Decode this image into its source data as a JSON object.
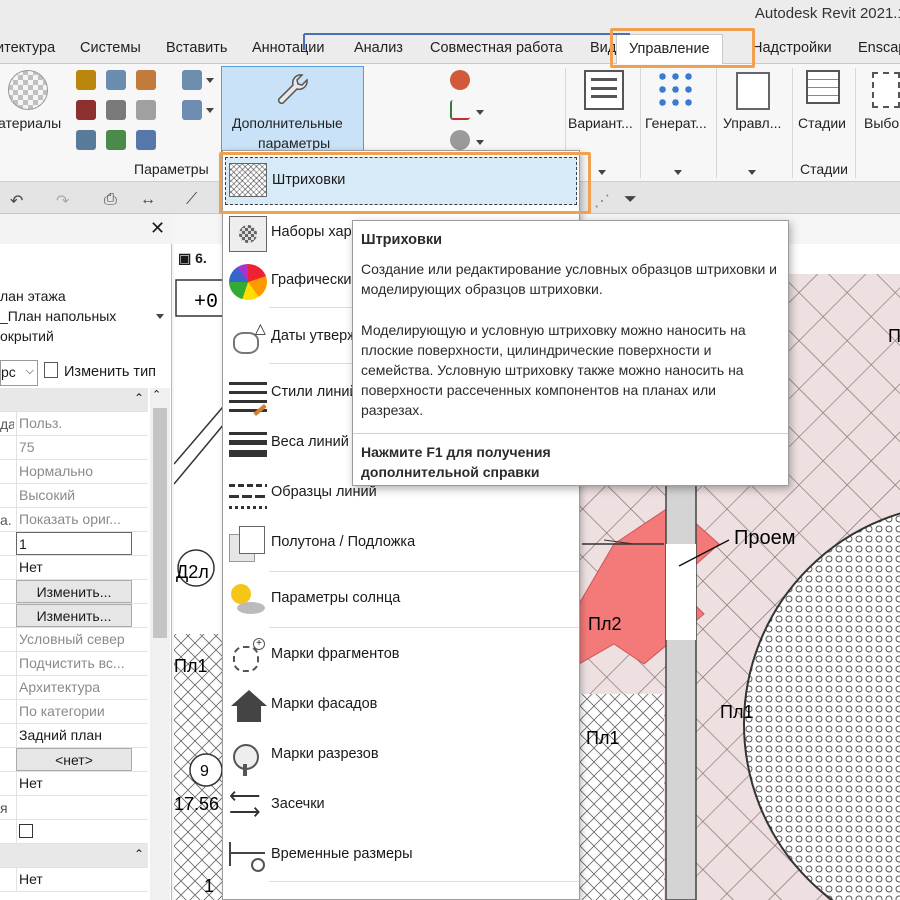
{
  "app": {
    "title": "Autodesk Revit 2021.1."
  },
  "tabs": [
    {
      "label": "итектура"
    },
    {
      "label": "Системы"
    },
    {
      "label": "Вставить"
    },
    {
      "label": "Аннотации"
    },
    {
      "label": "Анализ"
    },
    {
      "label": "Совместная работа"
    },
    {
      "label": "Вид"
    },
    {
      "label": "Управление"
    },
    {
      "label": "Надстройки"
    },
    {
      "label": "Enscap"
    }
  ],
  "ribbon": {
    "materials_label": "атериалы",
    "additional_params_line1": "Дополнительные",
    "additional_params_line2": "параметры",
    "params_panel_label": "Параметры",
    "options_label": "Вариант...",
    "generate_label": "Генерат...",
    "manage_label": "Управл...",
    "phases_label": "Стадии",
    "phases_panel_label": "Стадии",
    "select_label": "Выбо"
  },
  "properties": {
    "type_line1": "лан этажа",
    "type_line2": "_План напольных",
    "type_line3": "окрытий",
    "selector": "рс",
    "edit_type": "Изменить тип",
    "rows": [
      {
        "key": "да",
        "value": "Польз."
      },
      {
        "key": "",
        "value": "75"
      },
      {
        "key": "",
        "value": "Нормально"
      },
      {
        "key": "",
        "value": "Высокий"
      },
      {
        "key": "а.",
        "value": "Показать ориг..."
      },
      {
        "key": "",
        "value": "1"
      },
      {
        "key": "",
        "value": "Нет"
      },
      {
        "key": "",
        "value": "Изменить..."
      },
      {
        "key": "",
        "value": "Изменить..."
      },
      {
        "key": "",
        "value": "Условный север"
      },
      {
        "key": "",
        "value": "Подчистить вс..."
      },
      {
        "key": "",
        "value": "Архитектура"
      },
      {
        "key": "",
        "value": "По категории"
      },
      {
        "key": "",
        "value": "Задний план"
      },
      {
        "key": "",
        "value": "<нет>"
      },
      {
        "key": "",
        "value": "Нет"
      },
      {
        "key": "я",
        "value": ""
      },
      {
        "key": "",
        "value": ""
      },
      {
        "key": "",
        "value": ""
      },
      {
        "key": "",
        "value": "Нет"
      }
    ]
  },
  "menu": {
    "items": [
      {
        "label": "Штриховки"
      },
      {
        "label": "Наборы хар"
      },
      {
        "label": "Графически"
      },
      {
        "label": "Даты утверж"
      },
      {
        "label": "Стили линий"
      },
      {
        "label": "Веса линий"
      },
      {
        "label": "Образцы линий"
      },
      {
        "label": "Полутона / Подложка"
      },
      {
        "label": "Параметры солнца"
      },
      {
        "label": "Марки фрагментов"
      },
      {
        "label": "Марки фасадов"
      },
      {
        "label": "Марки разрезов"
      },
      {
        "label": "Засечки"
      },
      {
        "label": "Временные размеры"
      }
    ]
  },
  "tooltip": {
    "title": "Штриховки",
    "p1": "Создание или редактирование условных образцов штриховки и моделирующих образцов штриховки.",
    "p2": "Моделирующую и условную штриховку можно наносить на плоские поверхности, цилиндрические поверхности и семейства. Условную штриховку также можно наносить на поверхности рассеченных компонентов на планах или разрезах.",
    "footer": "Нажмите F1 для получения дополнительной справки"
  },
  "drawing": {
    "tab_label": "6.",
    "level": "+0.",
    "labels": [
      "Проем",
      "Пл2",
      "Пл1",
      "Пл1",
      "Пл1",
      "Д2л",
      "9",
      "17.56",
      "1",
      "П"
    ]
  },
  "colors": {
    "accent_orange": "#f0a050",
    "menu_highlight": "#d6eaf8",
    "hatch_red": "#f47a7a"
  }
}
